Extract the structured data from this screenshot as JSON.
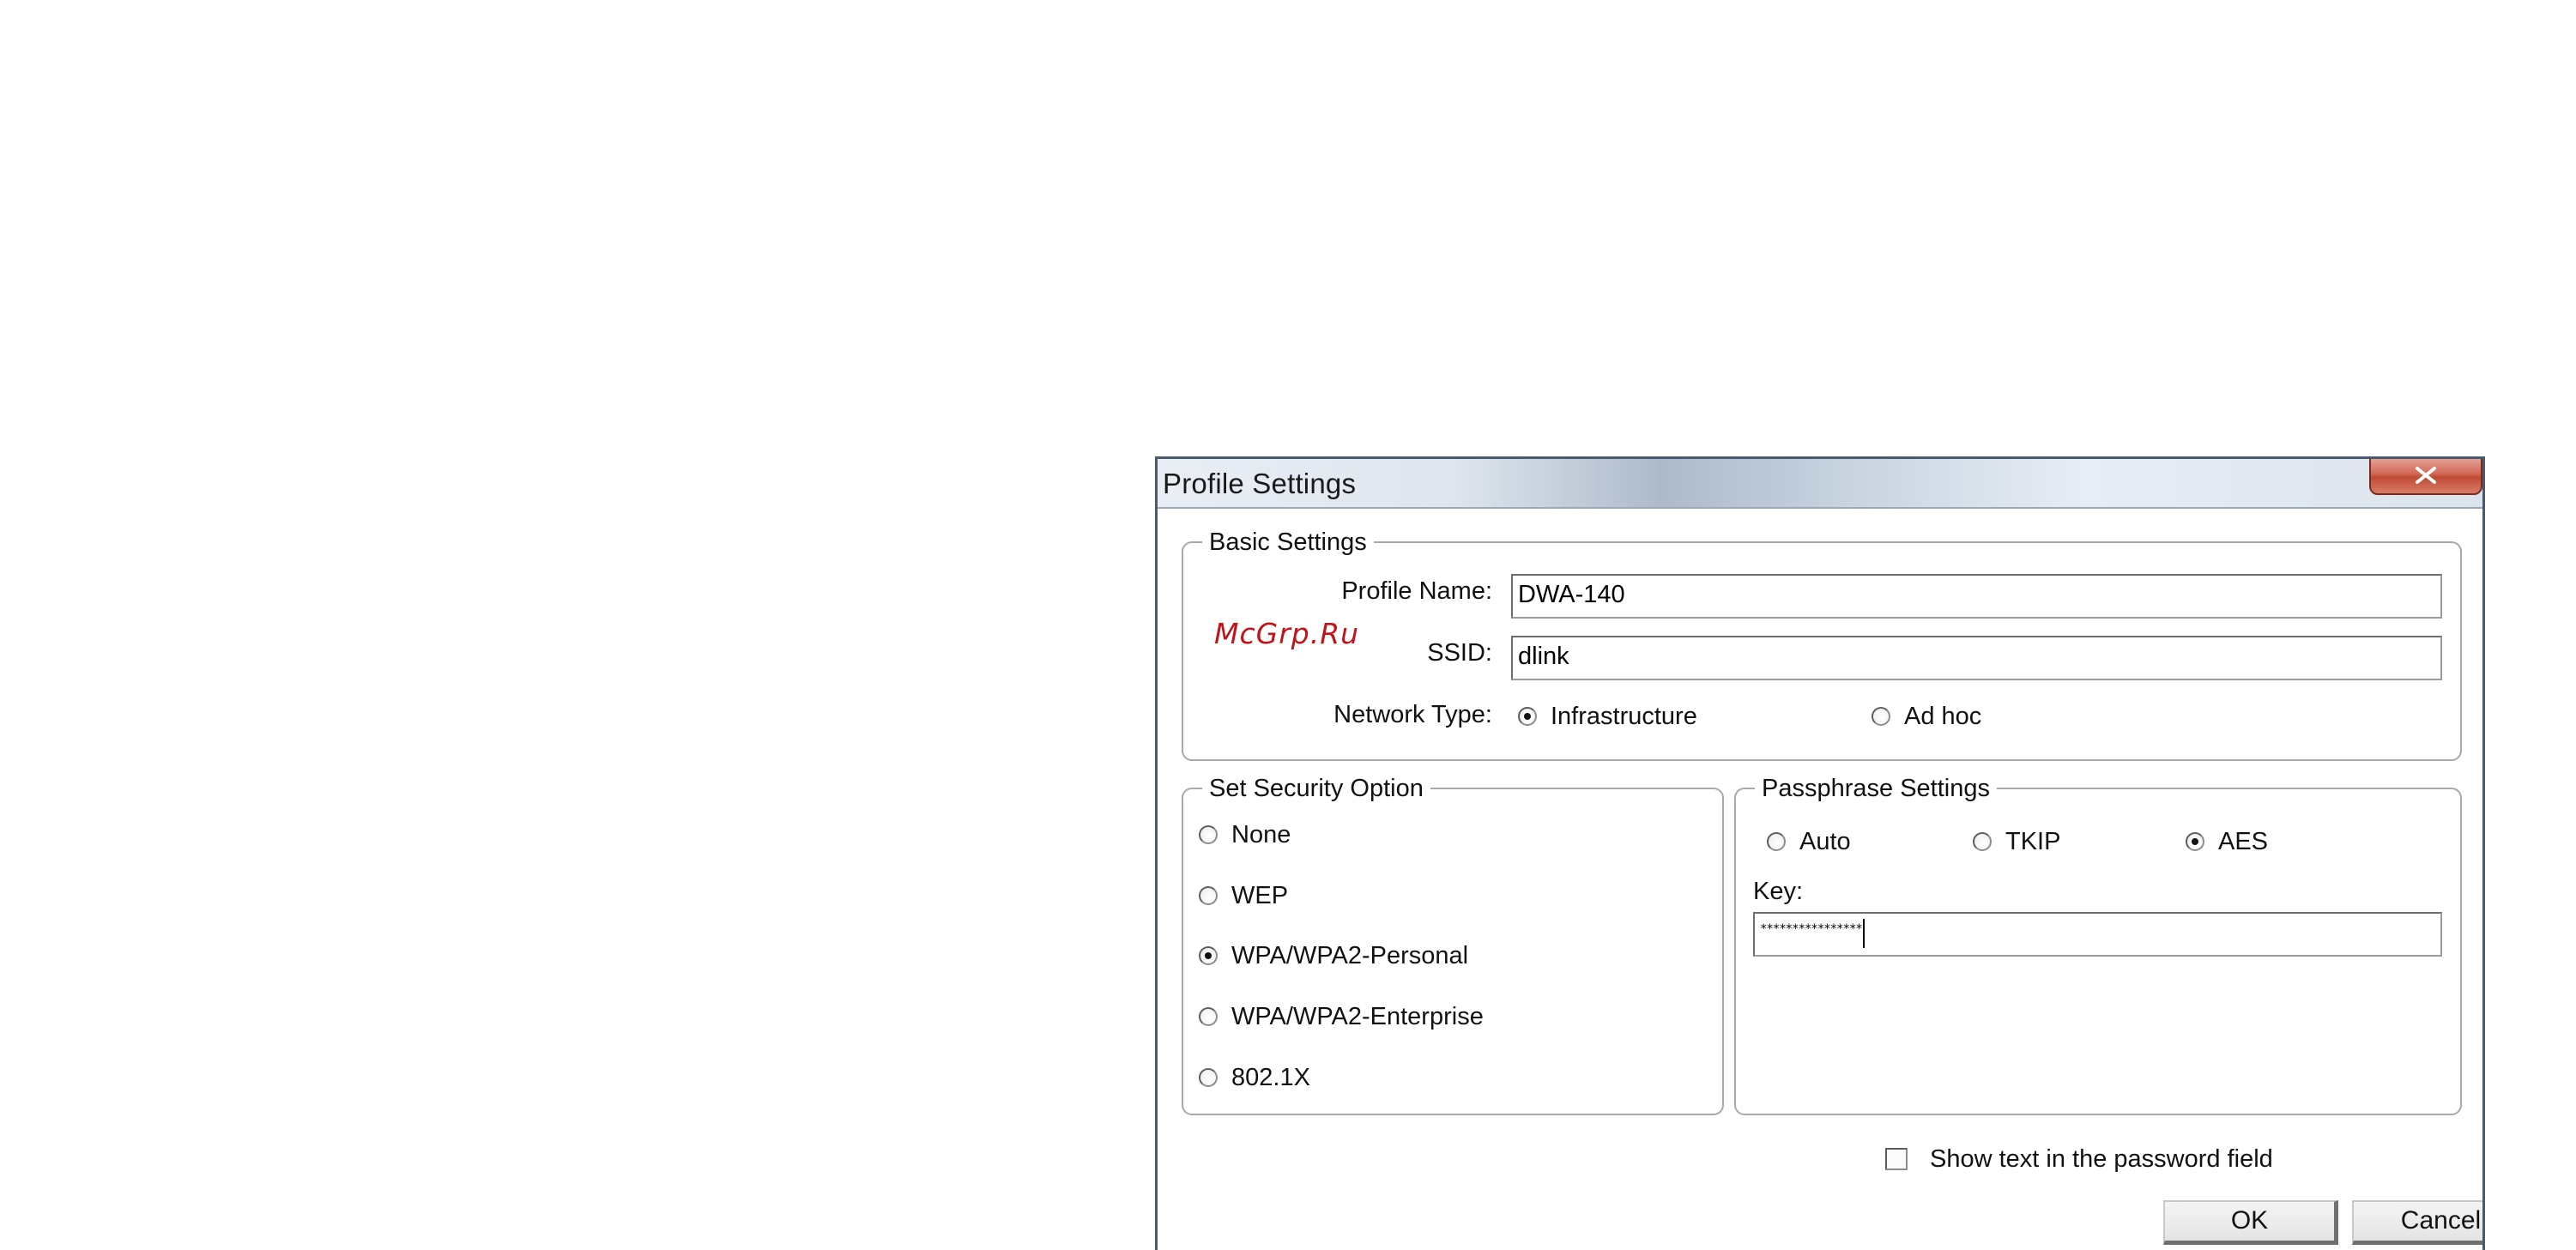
{
  "window": {
    "title": "Profile Settings",
    "close_symbol": "x"
  },
  "watermark": "McGrp.Ru",
  "basic_settings": {
    "legend": "Basic Settings",
    "profile_name_label": "Profile Name:",
    "profile_name_value": "DWA-140",
    "ssid_label": "SSID:",
    "ssid_value": "dlink",
    "network_type_label": "Network Type:",
    "network_types": [
      {
        "label": "Infrastructure",
        "checked": true
      },
      {
        "label": "Ad hoc",
        "checked": false
      }
    ]
  },
  "security": {
    "legend": "Set Security Option",
    "options": [
      {
        "label": "None",
        "checked": false
      },
      {
        "label": "WEP",
        "checked": false
      },
      {
        "label": "WPA/WPA2-Personal",
        "checked": true
      },
      {
        "label": "WPA/WPA2-Enterprise",
        "checked": false
      },
      {
        "label": "802.1X",
        "checked": false
      }
    ]
  },
  "passphrase": {
    "legend": "Passphrase Settings",
    "ciphers": [
      {
        "label": "Auto",
        "checked": false
      },
      {
        "label": "TKIP",
        "checked": false
      },
      {
        "label": "AES",
        "checked": true
      }
    ],
    "key_label": "Key:",
    "key_value": "****************"
  },
  "show_text": {
    "label": "Show text in the password field",
    "checked": false
  },
  "buttons": {
    "ok": "OK",
    "cancel": "Cancel"
  },
  "icons": {
    "close": "close-icon"
  }
}
